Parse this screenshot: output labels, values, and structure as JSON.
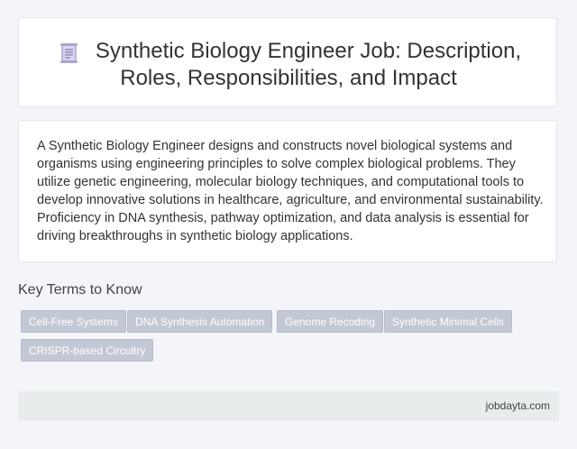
{
  "header": {
    "icon": "document-scroll-icon",
    "title_line1": "Synthetic Biology Engineer Job: Description,",
    "title_line2": "Roles, Responsibilities, and Impact"
  },
  "description": {
    "text": "A Synthetic Biology Engineer designs and constructs novel biological systems and organisms using engineering principles to solve complex biological problems. They utilize genetic engineering, molecular biology techniques, and computational tools to develop innovative solutions in healthcare, agriculture, and environmental sustainability. Proficiency in DNA synthesis, pathway optimization, and data analysis is essential for driving breakthroughs in synthetic biology applications."
  },
  "key_terms": {
    "heading": "Key Terms to Know",
    "tags": [
      "Cell-Free Systems",
      "DNA Synthesis Automation",
      "Genome Recoding",
      "Synthetic Minimal Cells",
      "CRISPR-based Circuitry"
    ]
  },
  "footer": {
    "site": "jobdayta.com"
  }
}
